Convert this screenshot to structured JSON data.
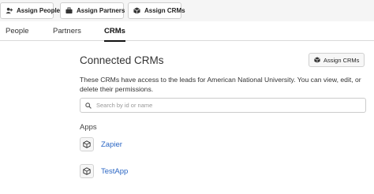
{
  "toolbar": {
    "buttons": [
      {
        "label": "Assign People",
        "icon": "person-plus-icon"
      },
      {
        "label": "Assign Partners",
        "icon": "briefcase-icon"
      },
      {
        "label": "Assign CRMs",
        "icon": "cube-icon"
      }
    ]
  },
  "tabs": [
    {
      "label": "People",
      "active": false
    },
    {
      "label": "Partners",
      "active": false
    },
    {
      "label": "CRMs",
      "active": true
    }
  ],
  "main": {
    "title": "Connected CRMs",
    "assign_button": "Assign CRMs",
    "description": "These CRMs have access to the leads for American National University. You can view, edit, or delete their permissions.",
    "search_placeholder": "Search by id or name",
    "apps_heading": "Apps",
    "apps": [
      {
        "name": "Zapier",
        "icon": "cube-icon"
      },
      {
        "name": "TestApp",
        "icon": "cube-icon"
      }
    ]
  },
  "colors": {
    "link": "#2a66c4",
    "toolbar_bg": "#f5f5f5"
  }
}
